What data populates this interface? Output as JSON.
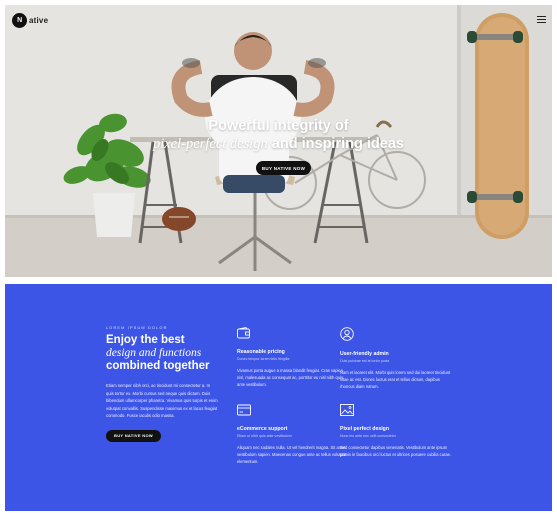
{
  "header": {
    "logo_mark": "N",
    "logo_text": "ative"
  },
  "hero": {
    "title_line1": "Powerful integrity of",
    "title_line2_script": "pixel-perfect design",
    "title_line2_rest": " and inspiring ideas",
    "cta_label": "BUY NATIVE NOW"
  },
  "features_section": {
    "background_color": "#3d55e6",
    "eyebrow": "LOREM IPSUM DOLOR",
    "heading_line1": "Enjoy the best",
    "heading_line2": "design and functions",
    "heading_line3": "combined together",
    "description": "Etiam semper nibh orci, ac tincidunt mi consectetur a. In quis tortor ex. Morbi cursus sed neque quis dictum. Duis bibendum ullamcorper pharetra. Vivamus quis turpis et enim volutpat convallis. Suspendisse maximus ex et lacus feugiat commodo. Fusce iaculis odio massa.",
    "cta_label": "BUY NATIVE NOW",
    "items": [
      {
        "icon": "wallet-icon",
        "title": "Reasonable pricing",
        "subtitle": "Donec tempor lorem felis fringilla",
        "description": "Vivamus porta augue a massa blandit feugiat. Cras sapien nisl, malesuada ac consequat ac, porttitor eu nisl nibh quis ante vestibulum."
      },
      {
        "icon": "user-icon",
        "title": "User-friendly admin",
        "subtitle": "Duis pulvinar est at tortor porta",
        "description": "Nam et laoreet elit. Morbi quis lorem sed dui laoreet tincidunt vitae ac est. Donec luctus erat et tellus dictum, dapibus rhoncus diam rutrum."
      },
      {
        "icon": "card-icon",
        "title": "eCommerce support",
        "subtitle": "Etiam ut nibh quis ante vestibulum",
        "description": "Aliquam nec sodales nulla. Ut vel hendrerit magna. Sit amet vestibulum sapien. Maecenas congue ante ac tellus volutpat elementum."
      },
      {
        "icon": "image-icon",
        "title": "Pixel perfect design",
        "subtitle": "Nunc leo ante nec velit consectetur",
        "description": "Sed consectetur dapibus venenatis. Vestibulum ante ipsum primis in faucibus orci luctus et ultrices posuere cubilia curae."
      }
    ]
  }
}
